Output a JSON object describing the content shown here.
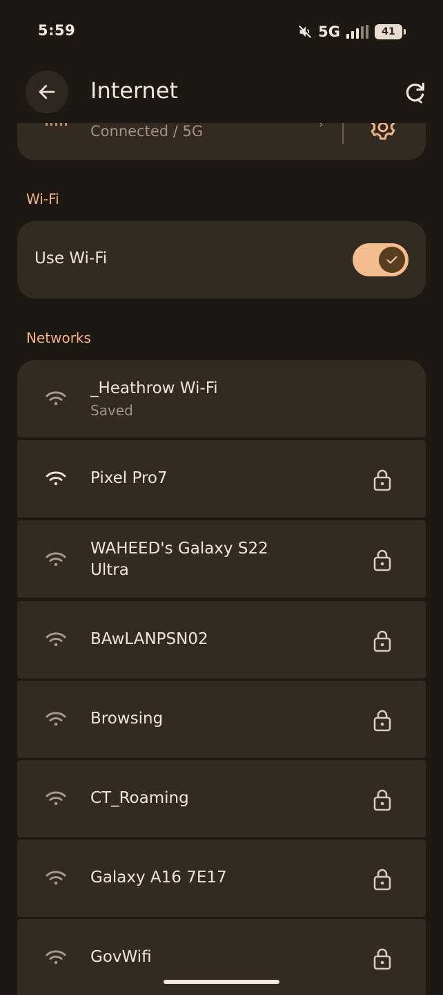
{
  "status_bar": {
    "time": "5:59",
    "network": "5G",
    "battery": "41"
  },
  "app_bar": {
    "title": "Internet"
  },
  "mobile": {
    "status": "Connected / 5G"
  },
  "wifi_section": {
    "header": "Wi-Fi",
    "toggle_label": "Use Wi-Fi",
    "enabled": true
  },
  "networks_section": {
    "header": "Networks",
    "items": [
      {
        "name": "_Heathrow Wi-Fi",
        "subtitle": "Saved",
        "locked": false
      },
      {
        "name": "Pixel Pro7",
        "subtitle": "",
        "locked": true
      },
      {
        "name": "WAHEED's Galaxy S22",
        "name_line2": "Ultra",
        "subtitle": "",
        "locked": true
      },
      {
        "name": "BAwLANPSN02",
        "subtitle": "",
        "locked": true
      },
      {
        "name": "Browsing",
        "subtitle": "",
        "locked": true
      },
      {
        "name": "CT_Roaming",
        "subtitle": "",
        "locked": true
      },
      {
        "name": "Galaxy A16 7E17",
        "subtitle": "",
        "locked": true
      },
      {
        "name": "GovWifi",
        "subtitle": "",
        "locked": true
      }
    ]
  },
  "colors": {
    "background": "#1e1813",
    "card": "#332a22",
    "accent": "#f0b48a",
    "toggle_track": "#f3bd8f"
  },
  "icons": {
    "back": "arrow-left-icon",
    "refresh": "refresh-icon",
    "wifi": "wifi-icon",
    "lock": "lock-icon",
    "settings": "gear-icon",
    "mute": "mute-icon",
    "signal": "signal-icon",
    "battery": "battery-icon",
    "check": "check-icon"
  }
}
